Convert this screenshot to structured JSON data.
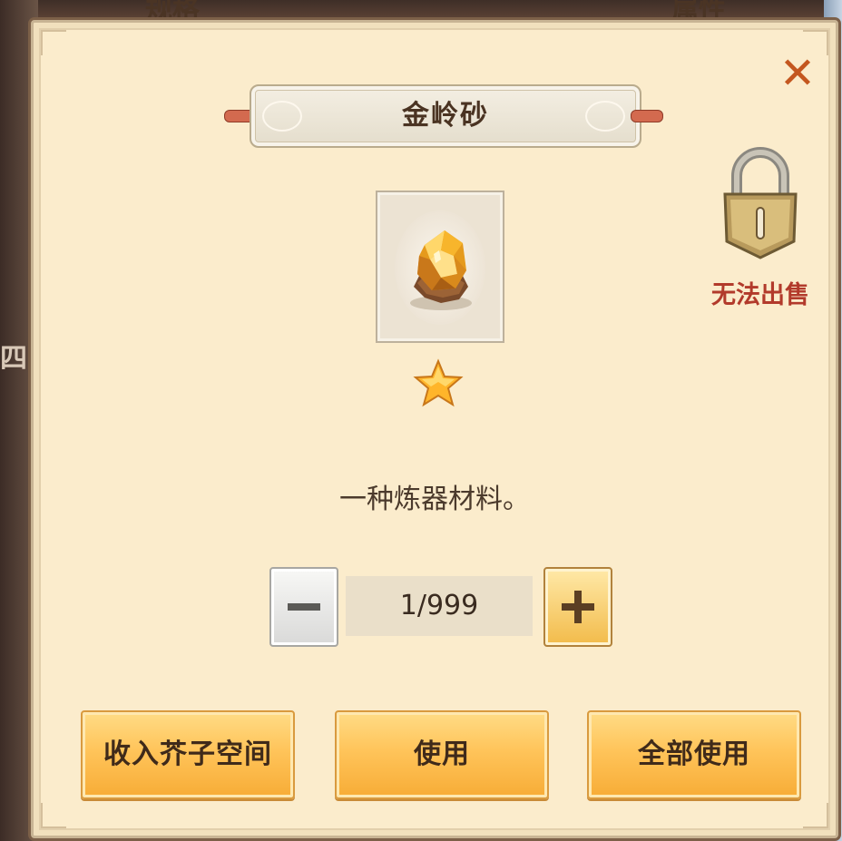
{
  "background": {
    "left_text": "四品",
    "top_text_left": "规格",
    "top_text_right": "属性"
  },
  "dialog": {
    "title": "金岭砂",
    "close_icon": "close-x-icon",
    "item_icon": "golden-ore-gem-icon",
    "rarity_stars": 1,
    "lock_label": "无法出售",
    "description": "一种炼器材料。",
    "quantity": {
      "display": "1/999",
      "current": 1,
      "max": 999
    },
    "buttons": {
      "store_label": "收入芥子空间",
      "use_label": "使用",
      "use_all_label": "全部使用"
    }
  },
  "colors": {
    "panel": "#fbeccc",
    "accent_gold": "#ffc45a",
    "close_orange": "#c4571f",
    "warning_red": "#b23a2b",
    "text_dark": "#4a3322"
  }
}
